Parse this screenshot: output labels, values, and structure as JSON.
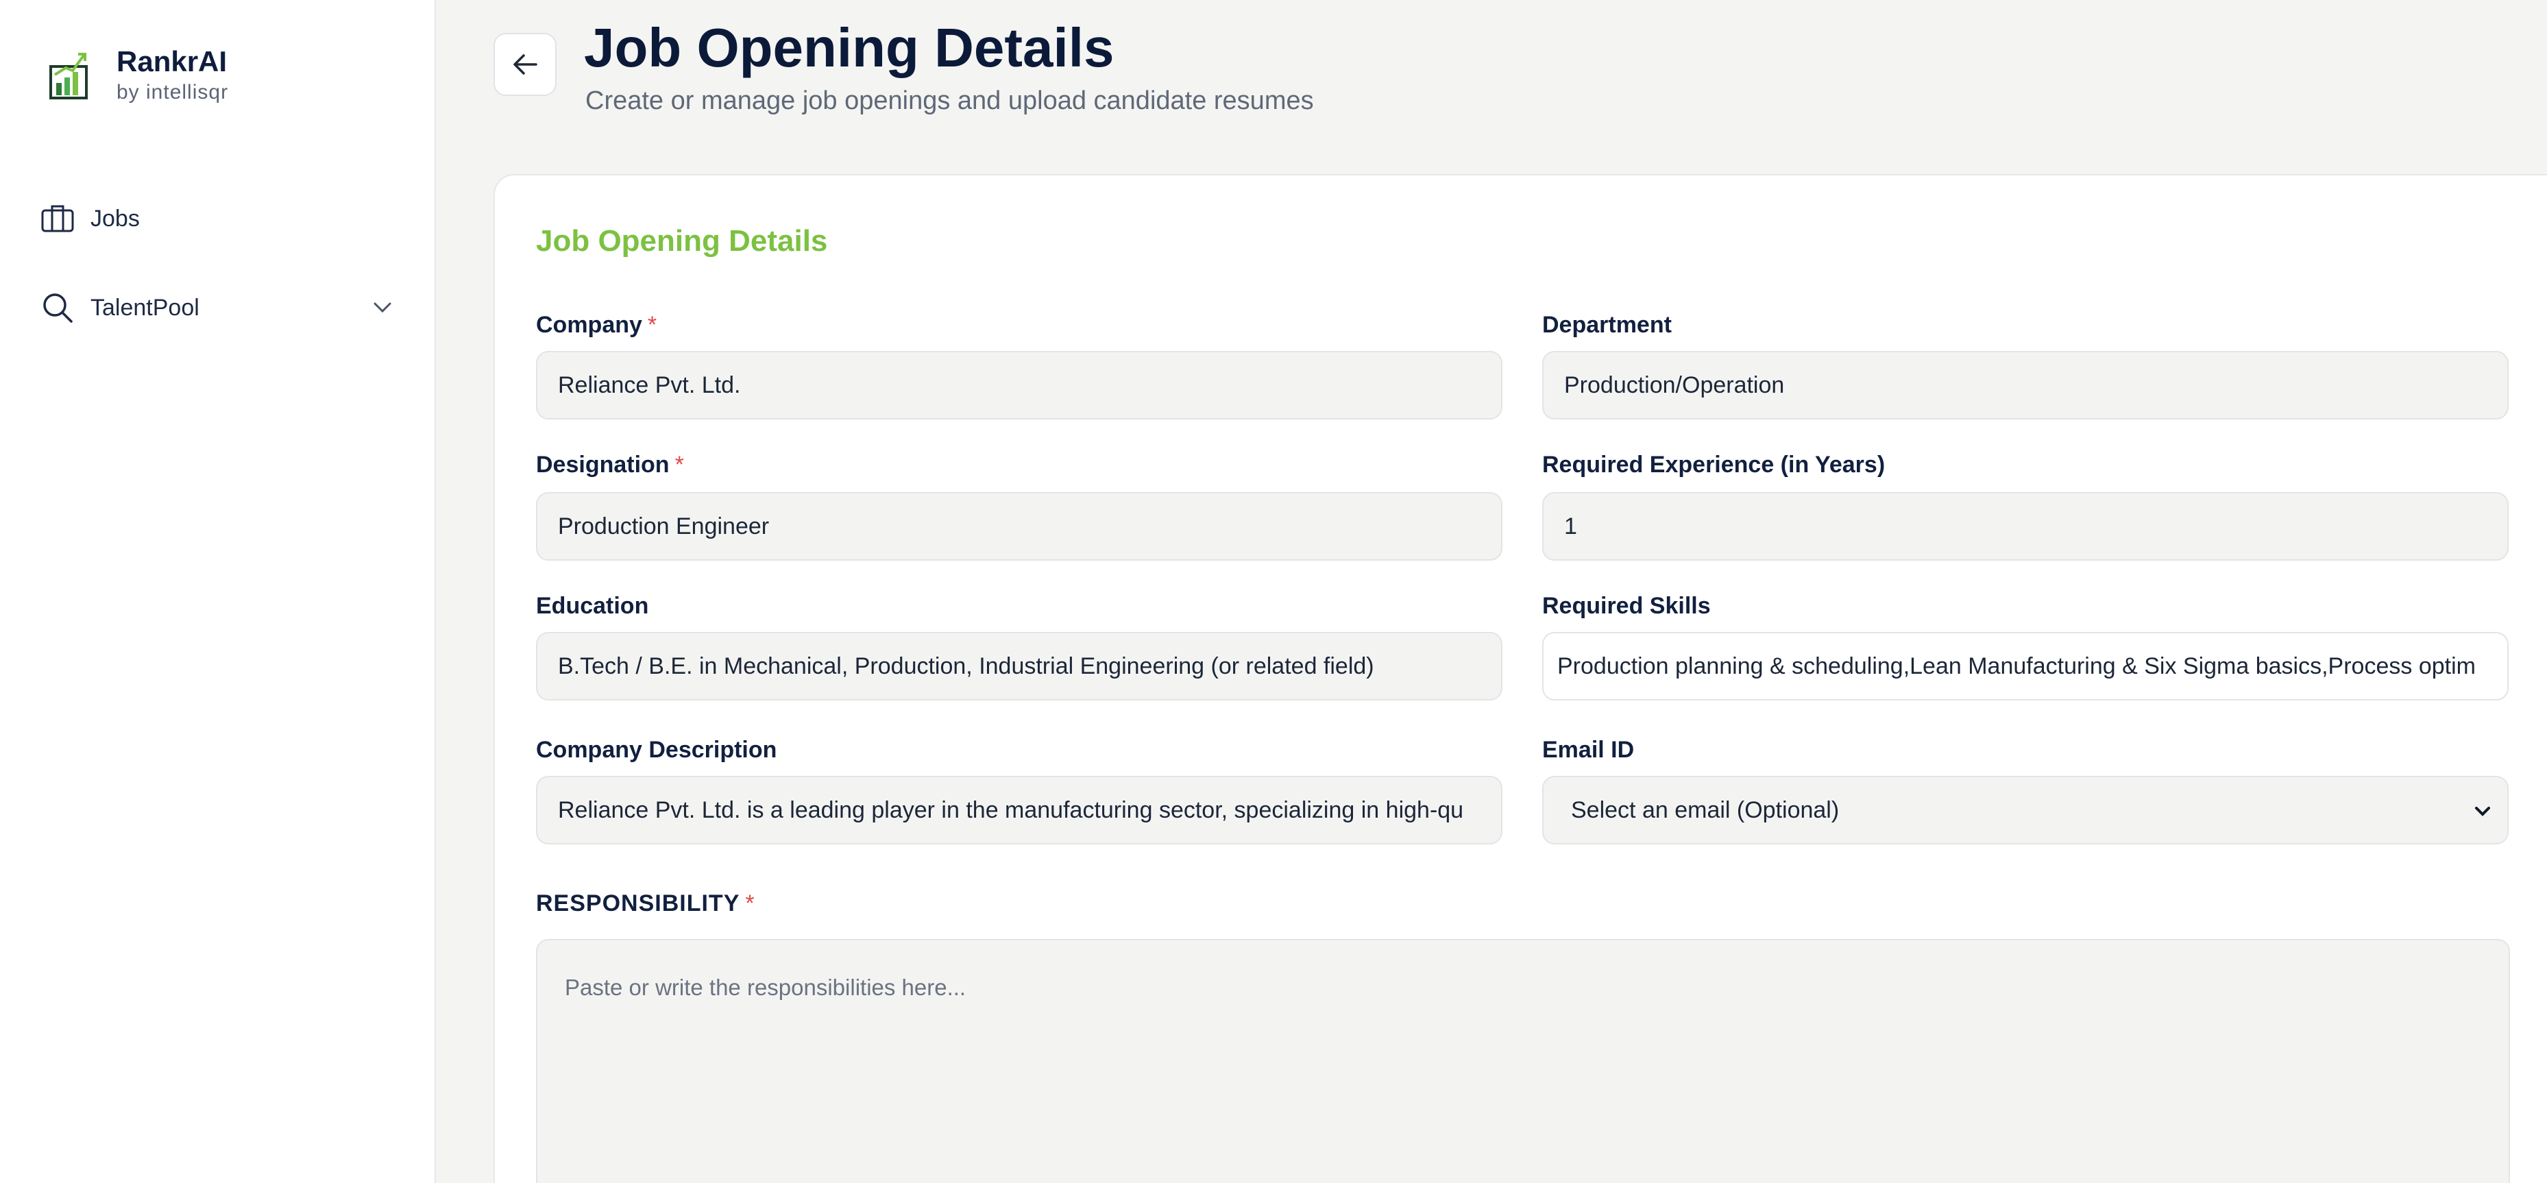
{
  "brand": {
    "name": "RankrAI",
    "sub": "by intellisqr",
    "logo_color": "#1f6f3a"
  },
  "sidebar": {
    "items": [
      {
        "label": "Jobs",
        "icon": "briefcase-icon"
      },
      {
        "label": "TalentPool",
        "icon": "search-icon",
        "has_chevron": true
      }
    ]
  },
  "header": {
    "title": "Job Opening Details",
    "subtitle": "Create or manage job openings and upload candidate resumes"
  },
  "form": {
    "section_title": "Job Opening Details",
    "required_mark": "*",
    "company": {
      "label": "Company",
      "value": "Reliance Pvt. Ltd."
    },
    "department": {
      "label": "Department",
      "value": "Production/Operation"
    },
    "designation": {
      "label": "Designation",
      "value": "Production Engineer"
    },
    "experience": {
      "label": "Required Experience (in Years)",
      "value": "1"
    },
    "education": {
      "label": "Education",
      "value": "B.Tech / B.E. in Mechanical, Production, Industrial Engineering (or related field)"
    },
    "skills": {
      "label": "Required Skills",
      "value": "Production planning & scheduling,Lean Manufacturing & Six Sigma basics,Process optim"
    },
    "company_description": {
      "label": "Company Description",
      "value": "Reliance Pvt. Ltd. is a leading player in the manufacturing sector, specializing in high-qu"
    },
    "email": {
      "label": "Email ID",
      "value": "Select an email (Optional)"
    },
    "responsibility": {
      "label": "RESPONSIBILITY",
      "placeholder": "Paste or write the responsibilities here..."
    }
  },
  "colors": {
    "accent_green": "#7cc142",
    "required_red": "#e04848",
    "title_navy": "#0c1a3a"
  }
}
